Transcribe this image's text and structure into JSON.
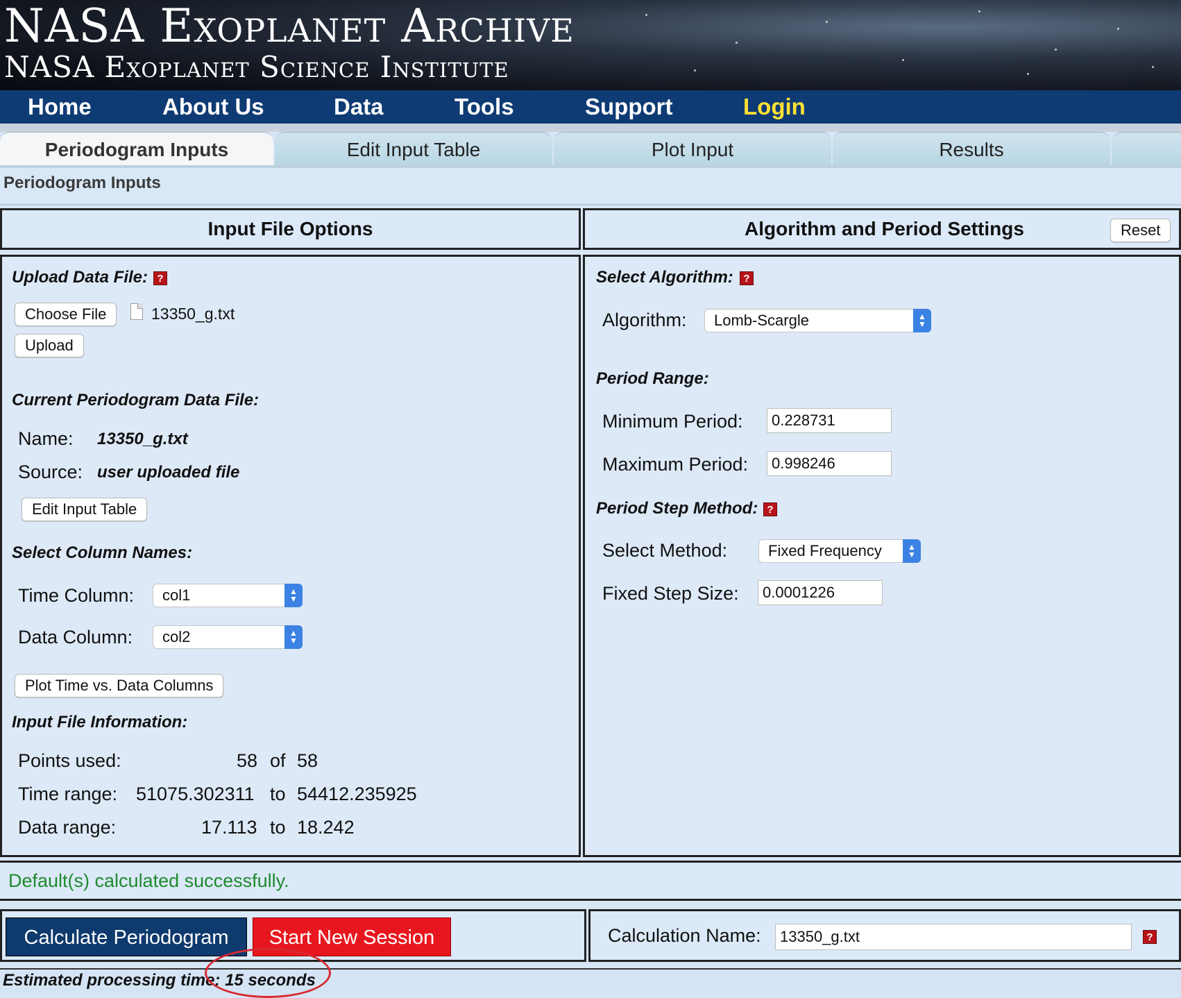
{
  "banner": {
    "title": "NASA Exoplanet Archive",
    "subtitle": "NASA Exoplanet Science Institute"
  },
  "nav": [
    {
      "label": "Home",
      "color": "#ffffff"
    },
    {
      "label": "About Us",
      "color": "#ffffff"
    },
    {
      "label": "Data",
      "color": "#ffffff"
    },
    {
      "label": "Tools",
      "color": "#ffffff"
    },
    {
      "label": "Support",
      "color": "#ffffff"
    },
    {
      "label": "Login",
      "color": "#ffe033"
    }
  ],
  "tabs": [
    {
      "label": "Periodogram Inputs",
      "active": true
    },
    {
      "label": "Edit Input Table",
      "active": false
    },
    {
      "label": "Plot Input",
      "active": false
    },
    {
      "label": "Results",
      "active": false
    }
  ],
  "section_title": "Periodogram Inputs",
  "left_panel": {
    "title": "Input File Options",
    "upload_label": "Upload Data File:",
    "choose_file_label": "Choose File",
    "chosen_file": "13350_g.txt",
    "upload_button": "Upload",
    "current_file_label": "Current Periodogram Data File:",
    "name_label": "Name:",
    "name_value": "13350_g.txt",
    "source_label": "Source:",
    "source_value": "user uploaded file",
    "edit_table_button": "Edit Input Table",
    "columns_label": "Select Column Names:",
    "time_column_label": "Time Column:",
    "time_column_value": "col1",
    "data_column_label": "Data Column:",
    "data_column_value": "col2",
    "plot_button": "Plot Time vs. Data Columns",
    "info_label": "Input File Information:",
    "points_label": "Points used:",
    "points_used": "58",
    "points_of": "of",
    "points_total": "58",
    "time_range_label": "Time range:",
    "time_min": "51075.302311",
    "time_to": "to",
    "time_max": "54412.235925",
    "data_range_label": "Data range:",
    "data_min": "17.113",
    "data_to": "to",
    "data_max": "18.242"
  },
  "right_panel": {
    "title": "Algorithm and Period Settings",
    "reset_button": "Reset",
    "select_algorithm_label": "Select Algorithm:",
    "algorithm_label": "Algorithm:",
    "algorithm_value": "Lomb-Scargle",
    "period_range_label": "Period Range:",
    "min_period_label": "Minimum Period:",
    "min_period_value": "0.228731",
    "max_period_label": "Maximum Period:",
    "max_period_value": "0.998246",
    "step_method_label": "Period Step Method:",
    "select_method_label": "Select Method:",
    "select_method_value": "Fixed Frequency",
    "step_size_label": "Fixed Step Size:",
    "step_size_value": "0.0001226"
  },
  "status": {
    "message": "Default(s) calculated successfully.",
    "color": "#1f8a2e"
  },
  "actions": {
    "calculate_button": "Calculate Periodogram",
    "new_session_button": "Start New Session",
    "calc_name_label": "Calculation Name:",
    "calc_name_value": "13350_g.txt"
  },
  "estimated_time": "Estimated processing time: 15 seconds",
  "help_glyph": "?"
}
